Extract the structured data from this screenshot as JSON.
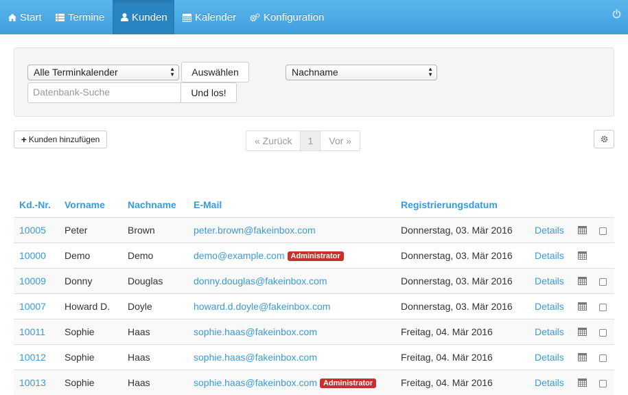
{
  "nav": {
    "items": [
      {
        "label": "Start",
        "icon": "home-icon"
      },
      {
        "label": "Termine",
        "icon": "list-icon"
      },
      {
        "label": "Kunden",
        "icon": "user-icon"
      },
      {
        "label": "Kalender",
        "icon": "calendar-icon"
      },
      {
        "label": "Konfiguration",
        "icon": "cogs-icon"
      }
    ],
    "active": "Kunden",
    "power_icon": "power-icon"
  },
  "filter": {
    "calendar_select": "Alle Terminkalender",
    "select_button": "Auswählen",
    "search_placeholder": "Datenbank-Suche",
    "search_button": "Und los!",
    "sort_select": "Nachname"
  },
  "toolbar": {
    "add_customer": "Kunden hinzufügen",
    "pager_prev": "« Zurück",
    "pager_current": "1",
    "pager_next": "Vor »"
  },
  "table": {
    "headers": {
      "id": "Kd.-Nr.",
      "first": "Vorname",
      "last": "Nachname",
      "email": "E-Mail",
      "registered": "Registrierungsdatum"
    },
    "details_label": "Details",
    "admin_badge": "Administrator",
    "rows": [
      {
        "id": "10005",
        "first": "Peter",
        "last": "Brown",
        "email": "peter.brown@fakeinbox.com",
        "admin": false,
        "date": "Donnerstag, 03. Mär 2016",
        "checkbox": true
      },
      {
        "id": "10000",
        "first": "Demo",
        "last": "Demo",
        "email": "demo@example.com",
        "admin": true,
        "date": "Donnerstag, 03. Mär 2016",
        "checkbox": false
      },
      {
        "id": "10009",
        "first": "Donny",
        "last": "Douglas",
        "email": "donny.douglas@fakeinbox.com",
        "admin": false,
        "date": "Donnerstag, 03. Mär 2016",
        "checkbox": true
      },
      {
        "id": "10007",
        "first": "Howard D.",
        "last": "Doyle",
        "email": "howard.d.doyle@fakeinbox.com",
        "admin": false,
        "date": "Donnerstag, 03. Mär 2016",
        "checkbox": true
      },
      {
        "id": "10011",
        "first": "Sophie",
        "last": "Haas",
        "email": "sophie.haas@fakeinbox.com",
        "admin": false,
        "date": "Freitag, 04. Mär 2016",
        "checkbox": true
      },
      {
        "id": "10012",
        "first": "Sophie",
        "last": "Haas",
        "email": "sophie.haas@fakeinbox.com",
        "admin": false,
        "date": "Freitag, 04. Mär 2016",
        "checkbox": true
      },
      {
        "id": "10013",
        "first": "Sophie",
        "last": "Haas",
        "email": "sophie.haas@fakeinbox.com",
        "admin": true,
        "date": "Freitag, 04. Mär 2016",
        "checkbox": true
      }
    ]
  },
  "colors": {
    "nav_top": "#5bb6ec",
    "nav_bottom": "#3f9fde",
    "nav_active": "#2a86c2",
    "link": "#3a9ad9",
    "admin_badge": "#c9302c"
  }
}
